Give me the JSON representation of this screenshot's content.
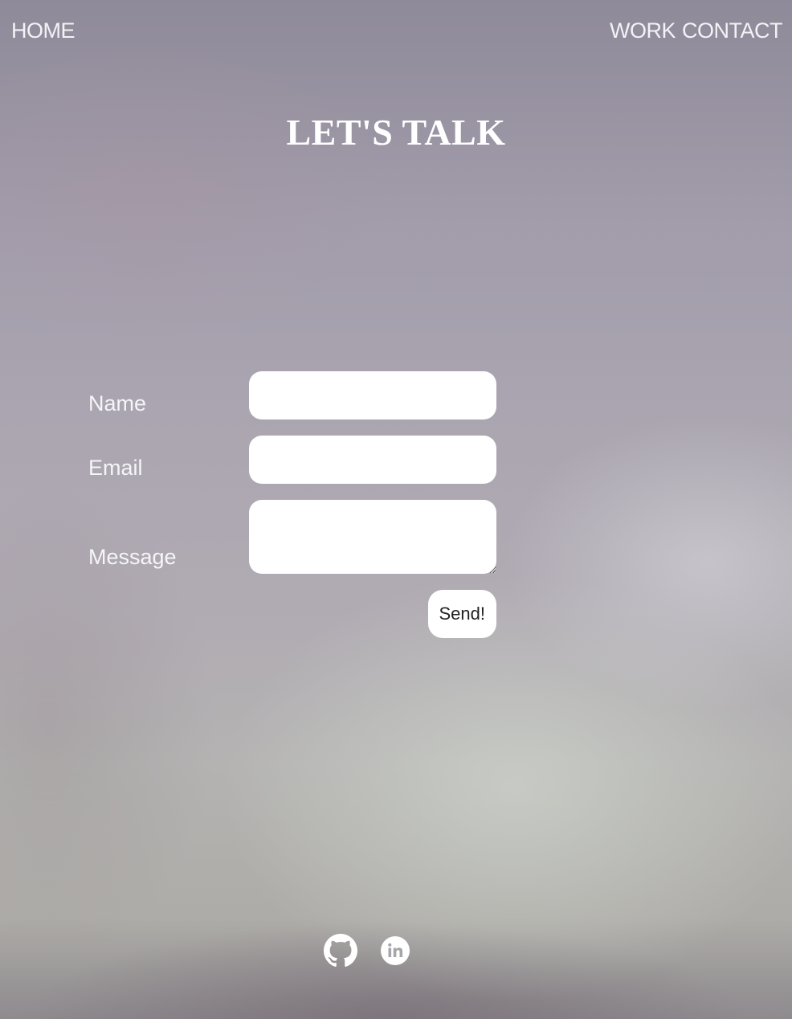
{
  "nav": {
    "home": "HOME",
    "work": "WORK",
    "contact": "CONTACT"
  },
  "page": {
    "title": "LET'S TALK"
  },
  "form": {
    "name_label": "Name",
    "name_value": "",
    "email_label": "Email",
    "email_value": "",
    "message_label": "Message",
    "message_value": "",
    "send_label": "Send!"
  },
  "social": {
    "icons": [
      "github-icon",
      "linkedin-icon"
    ],
    "icon_color": "#ffffff"
  }
}
